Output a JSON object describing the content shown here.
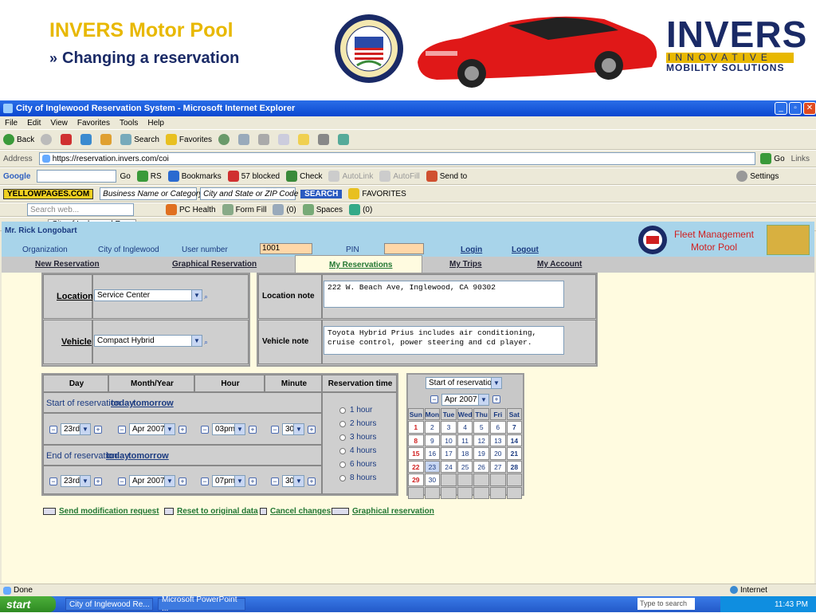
{
  "slide": {
    "title": "INVERS Motor Pool",
    "chevron": "»",
    "subtitle": "Changing a reservation",
    "logo": {
      "big": "INVERS",
      "line1": "INNOVATIVE",
      "line2": "MOBILITY SOLUTIONS"
    },
    "seal_text": "CITY OF INGLEWOOD · INC. CALIFORNIA 1908"
  },
  "browser": {
    "title": "City of Inglewood Reservation System - Microsoft Internet Explorer",
    "menu": [
      "File",
      "Edit",
      "View",
      "Favorites",
      "Tools",
      "Help"
    ],
    "toolbar": {
      "back": "Back",
      "search": "Search",
      "favorites": "Favorites"
    },
    "address_label": "Address",
    "address": "https://reservation.invers.com/coi",
    "go": "Go",
    "links": "Links",
    "google": {
      "label": "Google",
      "go": "Go",
      "bookmarks": "Bookmarks",
      "blocked": "57 blocked",
      "check": "Check",
      "autolink": "AutoLink",
      "autofill": "AutoFill",
      "sendto": "Send to",
      "settings": "Settings"
    },
    "yp": {
      "brand": "YELLOWPAGES.COM",
      "business": "Business Name or Category",
      "city": "City and State or ZIP Code",
      "search": "SEARCH",
      "favorites": "FAVORITES"
    },
    "row5": {
      "searchweb": "Search web...",
      "pchealth": "PC Health",
      "formfill": "Form Fill",
      "mail": "(0)",
      "spaces": "Spaces",
      "people": "(0)"
    },
    "tab": "City of Inglewood Re...",
    "status": "Done",
    "zone": "Internet"
  },
  "app": {
    "user": "Mr. Rick Longobart",
    "labels": {
      "organization": "Organization",
      "org_value": "City of Inglewood",
      "user_number": "User number",
      "pin": "PIN"
    },
    "user_number_value": "1001",
    "pin_value": "",
    "login": "Login",
    "logout": "Logout",
    "fleet": [
      "Fleet Management",
      "Motor Pool"
    ],
    "nav": [
      "New Reservation",
      "Graphical Reservation",
      "My Reservations",
      "My Trips",
      "My Account"
    ],
    "location": {
      "label": "Location",
      "value": "Service Center",
      "note_label": "Location note",
      "note": "222 W. Beach Ave, Inglewood, CA 90302"
    },
    "vehicle": {
      "label": "Vehicle",
      "value": "Compact Hybrid",
      "note_label": "Vehicle note",
      "note": "Toyota Hybrid Prius includes air conditioning, cruise control, power steering and cd player."
    },
    "table": {
      "headers": [
        "Day",
        "Month/Year",
        "Hour",
        "Minute",
        "Reservation time"
      ],
      "start_label": "Start of reservation",
      "end_label": "End of reservation",
      "today": "today",
      "tomorrow": "tomorrow",
      "start": {
        "day": "23rd",
        "month": "Apr 2007",
        "hour": "03pm",
        "minute": "30"
      },
      "end": {
        "day": "23rd",
        "month": "Apr 2007",
        "hour": "07pm",
        "minute": "30"
      },
      "durations": [
        "1 hour",
        "2 hours",
        "3 hours",
        "4 hours",
        "6 hours",
        "8 hours"
      ]
    },
    "calendar": {
      "mode": "Start of reservation",
      "month": "Apr 2007",
      "days": [
        "Sun",
        "Mon",
        "Tue",
        "Wed",
        "Thu",
        "Fri",
        "Sat"
      ],
      "weeks": [
        [
          "1",
          "2",
          "3",
          "4",
          "5",
          "6",
          "7"
        ],
        [
          "8",
          "9",
          "10",
          "11",
          "12",
          "13",
          "14"
        ],
        [
          "15",
          "16",
          "17",
          "18",
          "19",
          "20",
          "21"
        ],
        [
          "22",
          "23",
          "24",
          "25",
          "26",
          "27",
          "28"
        ],
        [
          "29",
          "30",
          "",
          "",
          "",
          "",
          ""
        ],
        [
          "",
          "",
          "",
          "",
          "",
          "",
          ""
        ]
      ]
    },
    "actions": [
      "Send modification request",
      "Reset to original data",
      "Cancel changes",
      "Graphical reservation"
    ]
  },
  "taskbar": {
    "start": "start",
    "tasks": [
      "City of Inglewood Re...",
      "Microsoft PowerPoint ..."
    ],
    "search": "Type to search",
    "time": "11:43 PM"
  }
}
